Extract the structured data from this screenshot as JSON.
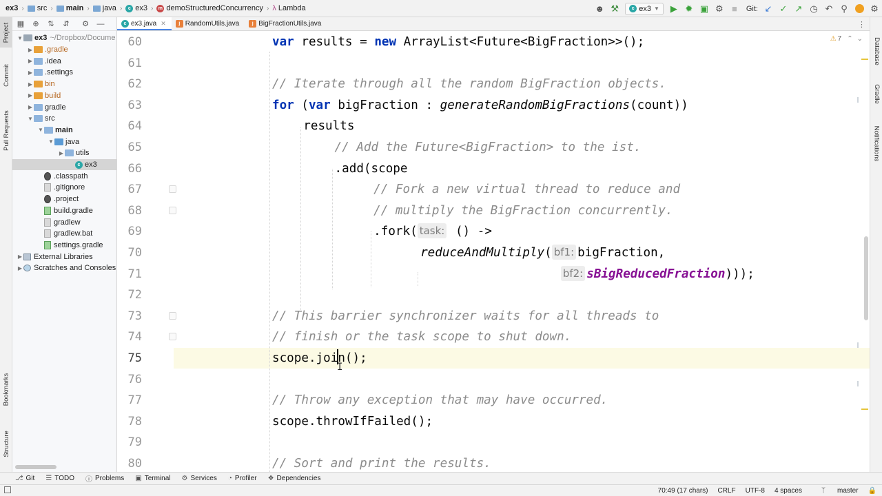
{
  "navbar": {
    "breadcrumbs": [
      {
        "label": "ex3",
        "kind": "project",
        "bold": true
      },
      {
        "label": "src",
        "kind": "folder"
      },
      {
        "label": "main",
        "kind": "folder",
        "bold": true
      },
      {
        "label": "java",
        "kind": "folder"
      },
      {
        "label": "ex3",
        "kind": "class"
      },
      {
        "label": "demoStructuredConcurrency",
        "kind": "method"
      },
      {
        "label": "Lambda",
        "kind": "lambda"
      }
    ],
    "run_config": "ex3",
    "git_label": "Git:",
    "icons": [
      "user-icon",
      "hammer-icon",
      "run-icon",
      "debug-icon",
      "coverage-icon",
      "profile-icon",
      "stop-icon",
      "update-icon",
      "commit-icon",
      "push-icon",
      "history-icon",
      "rollback-icon",
      "search-icon",
      "update-ide-icon",
      "settings-icon"
    ]
  },
  "left_strip": {
    "top_tabs": [
      "Project",
      "Commit",
      "Pull Requests"
    ],
    "bottom_tabs": [
      "Bookmarks",
      "Structure"
    ]
  },
  "project": {
    "tree": [
      {
        "label": "ex3",
        "note": "~/Dropbox/Docume",
        "depth": 0,
        "icon": "project",
        "expanded": true,
        "bold": true
      },
      {
        "label": ".gradle",
        "depth": 1,
        "icon": "folder-orange",
        "expanded": false,
        "orange": true
      },
      {
        "label": ".idea",
        "depth": 1,
        "icon": "folder",
        "expanded": false
      },
      {
        "label": ".settings",
        "depth": 1,
        "icon": "folder",
        "expanded": false
      },
      {
        "label": "bin",
        "depth": 1,
        "icon": "folder-orange",
        "expanded": false,
        "orange": true
      },
      {
        "label": "build",
        "depth": 1,
        "icon": "folder-orange",
        "expanded": false,
        "orange": true
      },
      {
        "label": "gradle",
        "depth": 1,
        "icon": "folder",
        "expanded": false
      },
      {
        "label": "src",
        "depth": 1,
        "icon": "folder",
        "expanded": true
      },
      {
        "label": "main",
        "depth": 2,
        "icon": "folder",
        "expanded": true,
        "bold": true
      },
      {
        "label": "java",
        "depth": 3,
        "icon": "folder-blue",
        "expanded": true
      },
      {
        "label": "utils",
        "depth": 4,
        "icon": "folder",
        "expanded": false
      },
      {
        "label": "ex3",
        "depth": 5,
        "icon": "class",
        "selected": true
      },
      {
        "label": ".classpath",
        "depth": 2,
        "icon": "file-dark"
      },
      {
        "label": ".gitignore",
        "depth": 2,
        "icon": "file"
      },
      {
        "label": ".project",
        "depth": 2,
        "icon": "file-dark"
      },
      {
        "label": "build.gradle",
        "depth": 2,
        "icon": "file-green"
      },
      {
        "label": "gradlew",
        "depth": 2,
        "icon": "file"
      },
      {
        "label": "gradlew.bat",
        "depth": 2,
        "icon": "file"
      },
      {
        "label": "settings.gradle",
        "depth": 2,
        "icon": "file-green"
      },
      {
        "label": "External Libraries",
        "depth": 0,
        "icon": "library",
        "expanded": false
      },
      {
        "label": "Scratches and Consoles",
        "depth": 0,
        "icon": "scratch",
        "expanded": false
      }
    ]
  },
  "tabs": [
    {
      "label": "ex3.java",
      "kind": "class",
      "active": true
    },
    {
      "label": "RandomUtils.java",
      "kind": "java",
      "active": false
    },
    {
      "label": "BigFractionUtils.java",
      "kind": "java",
      "active": false
    }
  ],
  "editor": {
    "warnings": "7",
    "current_line": 75,
    "lines": [
      {
        "n": "60",
        "indent": 0,
        "parts": [
          {
            "t": "var",
            "c": "kw"
          },
          {
            "t": " results = "
          },
          {
            "t": "new",
            "c": "kw"
          },
          {
            "t": " ArrayList<Future<BigFraction>>();"
          }
        ]
      },
      {
        "n": "61",
        "indent": 0,
        "parts": []
      },
      {
        "n": "62",
        "indent": 0,
        "parts": [
          {
            "t": "// Iterate through all the random BigFraction objects.",
            "c": "cmt"
          }
        ]
      },
      {
        "n": "63",
        "indent": 0,
        "parts": [
          {
            "t": "for",
            "c": "kw"
          },
          {
            "t": " ("
          },
          {
            "t": "var",
            "c": "kw"
          },
          {
            "t": " bigFraction : "
          },
          {
            "t": "generateRandomBigFractions",
            "c": "it"
          },
          {
            "t": "(count))"
          }
        ]
      },
      {
        "n": "64",
        "indent": 4,
        "parts": [
          {
            "t": "results"
          }
        ]
      },
      {
        "n": "65",
        "indent": 8,
        "parts": [
          {
            "t": "// Add the Future<BigFraction> to the ist.",
            "c": "cmt"
          }
        ]
      },
      {
        "n": "66",
        "indent": 8,
        "parts": [
          {
            "t": ".add(scope"
          }
        ]
      },
      {
        "n": "67",
        "indent": 13,
        "parts": [
          {
            "t": "// Fork a new virtual thread to reduce and",
            "c": "cmt"
          }
        ]
      },
      {
        "n": "68",
        "indent": 13,
        "parts": [
          {
            "t": "// multiply the BigFraction concurrently.",
            "c": "cmt"
          }
        ]
      },
      {
        "n": "69",
        "indent": 13,
        "parts": [
          {
            "t": ".fork("
          },
          {
            "t": "task:",
            "c": "hint"
          },
          {
            "t": " () ->"
          }
        ]
      },
      {
        "n": "70",
        "indent": 19,
        "parts": [
          {
            "t": "reduceAndMultiply",
            "c": "it"
          },
          {
            "t": "("
          },
          {
            "t": "bf1:",
            "c": "hint"
          },
          {
            "t": "bigFraction,"
          }
        ]
      },
      {
        "n": "71",
        "indent": 37,
        "parts": [
          {
            "t": "bf2:",
            "c": "hint"
          },
          {
            "t": "sBigReducedFraction",
            "c": "field"
          },
          {
            "t": ")));"
          }
        ]
      },
      {
        "n": "72",
        "indent": 0,
        "parts": []
      },
      {
        "n": "73",
        "indent": 0,
        "parts": [
          {
            "t": "// This barrier synchronizer waits for all threads to",
            "c": "cmt"
          }
        ]
      },
      {
        "n": "74",
        "indent": 0,
        "parts": [
          {
            "t": "// finish or the task scope to shut down.",
            "c": "cmt"
          }
        ]
      },
      {
        "n": "75",
        "indent": 0,
        "parts": [
          {
            "t": "scope.joi"
          },
          {
            "t": "",
            "c": "caret"
          },
          {
            "t": "n();"
          }
        ]
      },
      {
        "n": "76",
        "indent": 0,
        "parts": []
      },
      {
        "n": "77",
        "indent": 0,
        "parts": [
          {
            "t": "// Throw any exception that may have occurred.",
            "c": "cmt"
          }
        ]
      },
      {
        "n": "78",
        "indent": 0,
        "parts": [
          {
            "t": "scope.throwIfFailed();"
          }
        ]
      },
      {
        "n": "79",
        "indent": 0,
        "parts": []
      },
      {
        "n": "80",
        "indent": 0,
        "parts": [
          {
            "t": "// Sort and print the results.",
            "c": "cmt"
          }
        ]
      }
    ]
  },
  "right_strip": {
    "tabs": [
      "Database",
      "Gradle",
      "Notifications"
    ]
  },
  "bottom_tools": [
    {
      "label": "Git",
      "icon": "git-branch-icon"
    },
    {
      "label": "TODO",
      "icon": "list-icon"
    },
    {
      "label": "Problems",
      "icon": "problems-icon"
    },
    {
      "label": "Terminal",
      "icon": "terminal-icon"
    },
    {
      "label": "Services",
      "icon": "services-icon"
    },
    {
      "label": "Profiler",
      "icon": "profiler-icon"
    },
    {
      "label": "Dependencies",
      "icon": "dependencies-icon"
    }
  ],
  "statusbar": {
    "position": "70:49 (17 chars)",
    "line_sep": "CRLF",
    "encoding": "UTF-8",
    "indent": "4 spaces",
    "branch": "master"
  }
}
